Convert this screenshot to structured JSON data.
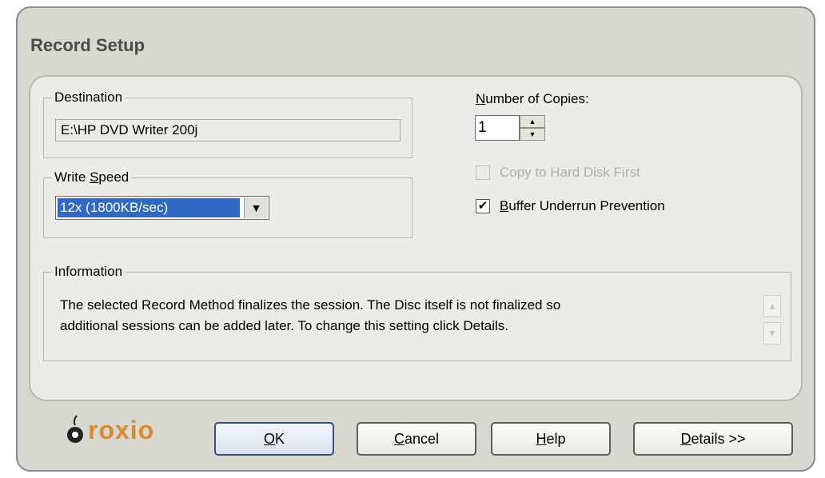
{
  "window": {
    "title": "Record Setup"
  },
  "destination": {
    "legend": "Destination",
    "value": "E:\\HP DVD Writer 200j"
  },
  "write_speed": {
    "legend_prefix": "Write ",
    "legend_accel": "S",
    "legend_suffix": "peed",
    "selected": "12x (1800KB/sec)"
  },
  "copies": {
    "label_accel": "N",
    "label_rest": "umber of Copies:",
    "value": "1"
  },
  "options": {
    "copy_to_hard_disk": {
      "label": "Copy to Hard Disk First",
      "checked": false,
      "enabled": false
    },
    "buffer_underrun": {
      "label_accel": "B",
      "label_rest": "uffer Underrun Prevention",
      "checked": true,
      "check_glyph": "✔"
    }
  },
  "information": {
    "legend": "Information",
    "line1": "The selected Record Method finalizes the session. The Disc itself is not finalized so",
    "line2": "additional sessions can be added later. To change this setting click Details."
  },
  "brand": {
    "logo_text": "roxio",
    "accent": "#d98a2c"
  },
  "buttons": {
    "ok": {
      "accel": "O",
      "rest": "K"
    },
    "cancel": {
      "accel": "C",
      "rest": "ancel"
    },
    "help": {
      "accel": "H",
      "rest": "elp"
    },
    "details": {
      "accel": "D",
      "rest": "etails >>"
    }
  }
}
